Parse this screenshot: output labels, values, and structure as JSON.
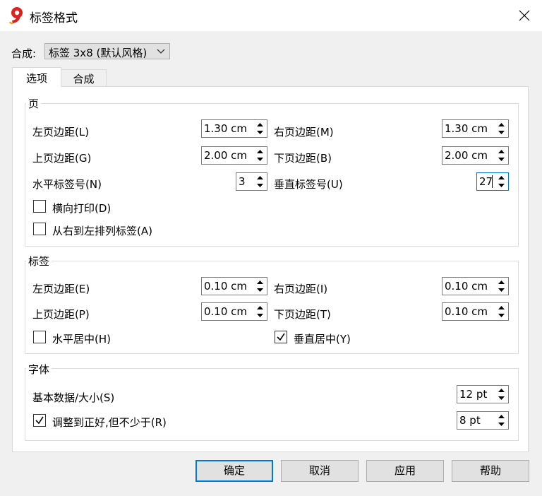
{
  "dialog": {
    "title": "标签格式",
    "app_icon": "app-logo-icon"
  },
  "compose": {
    "label": "合成:",
    "value": "标签 3x8 (默认风格)"
  },
  "tabs": [
    {
      "label": "选项"
    },
    {
      "label": "合成"
    }
  ],
  "page_group": {
    "title": "页",
    "left_margin": {
      "label": "左页边距(L)",
      "value": "1.30 cm"
    },
    "right_margin": {
      "label": "右页边距(M)",
      "value": "1.30 cm"
    },
    "top_margin": {
      "label": "上页边距(G)",
      "value": "2.00 cm"
    },
    "bottom_margin": {
      "label": "下页边距(B)",
      "value": "2.00 cm"
    },
    "horizontal_count": {
      "label": "水平标签号(N)",
      "value": "3"
    },
    "vertical_count": {
      "label": "垂直标签号(U)",
      "value": "27"
    },
    "landscape": {
      "label": "横向打印(D)",
      "checked": false
    },
    "right_to_left": {
      "label": "从右到左排列标签(A)",
      "checked": false
    }
  },
  "label_group": {
    "title": "标签",
    "left_margin": {
      "label": "左页边距(E)",
      "value": "0.10 cm"
    },
    "right_margin": {
      "label": "右页边距(I)",
      "value": "0.10 cm"
    },
    "top_margin": {
      "label": "上页边距(P)",
      "value": "0.10 cm"
    },
    "bottom_margin": {
      "label": "下页边距(T)",
      "value": "0.10 cm"
    },
    "h_center": {
      "label": "水平居中(H)",
      "checked": false
    },
    "v_center": {
      "label": "垂直居中(Y)",
      "checked": true
    }
  },
  "font_group": {
    "title": "字体",
    "base_size": {
      "label": "基本数据/大小(S)",
      "value": "12 pt"
    },
    "fit": {
      "label": "调整到正好,但不少于(R)",
      "checked": true,
      "value": "8 pt"
    }
  },
  "buttons": {
    "ok": "确定",
    "cancel": "取消",
    "apply": "应用",
    "help": "帮助"
  }
}
